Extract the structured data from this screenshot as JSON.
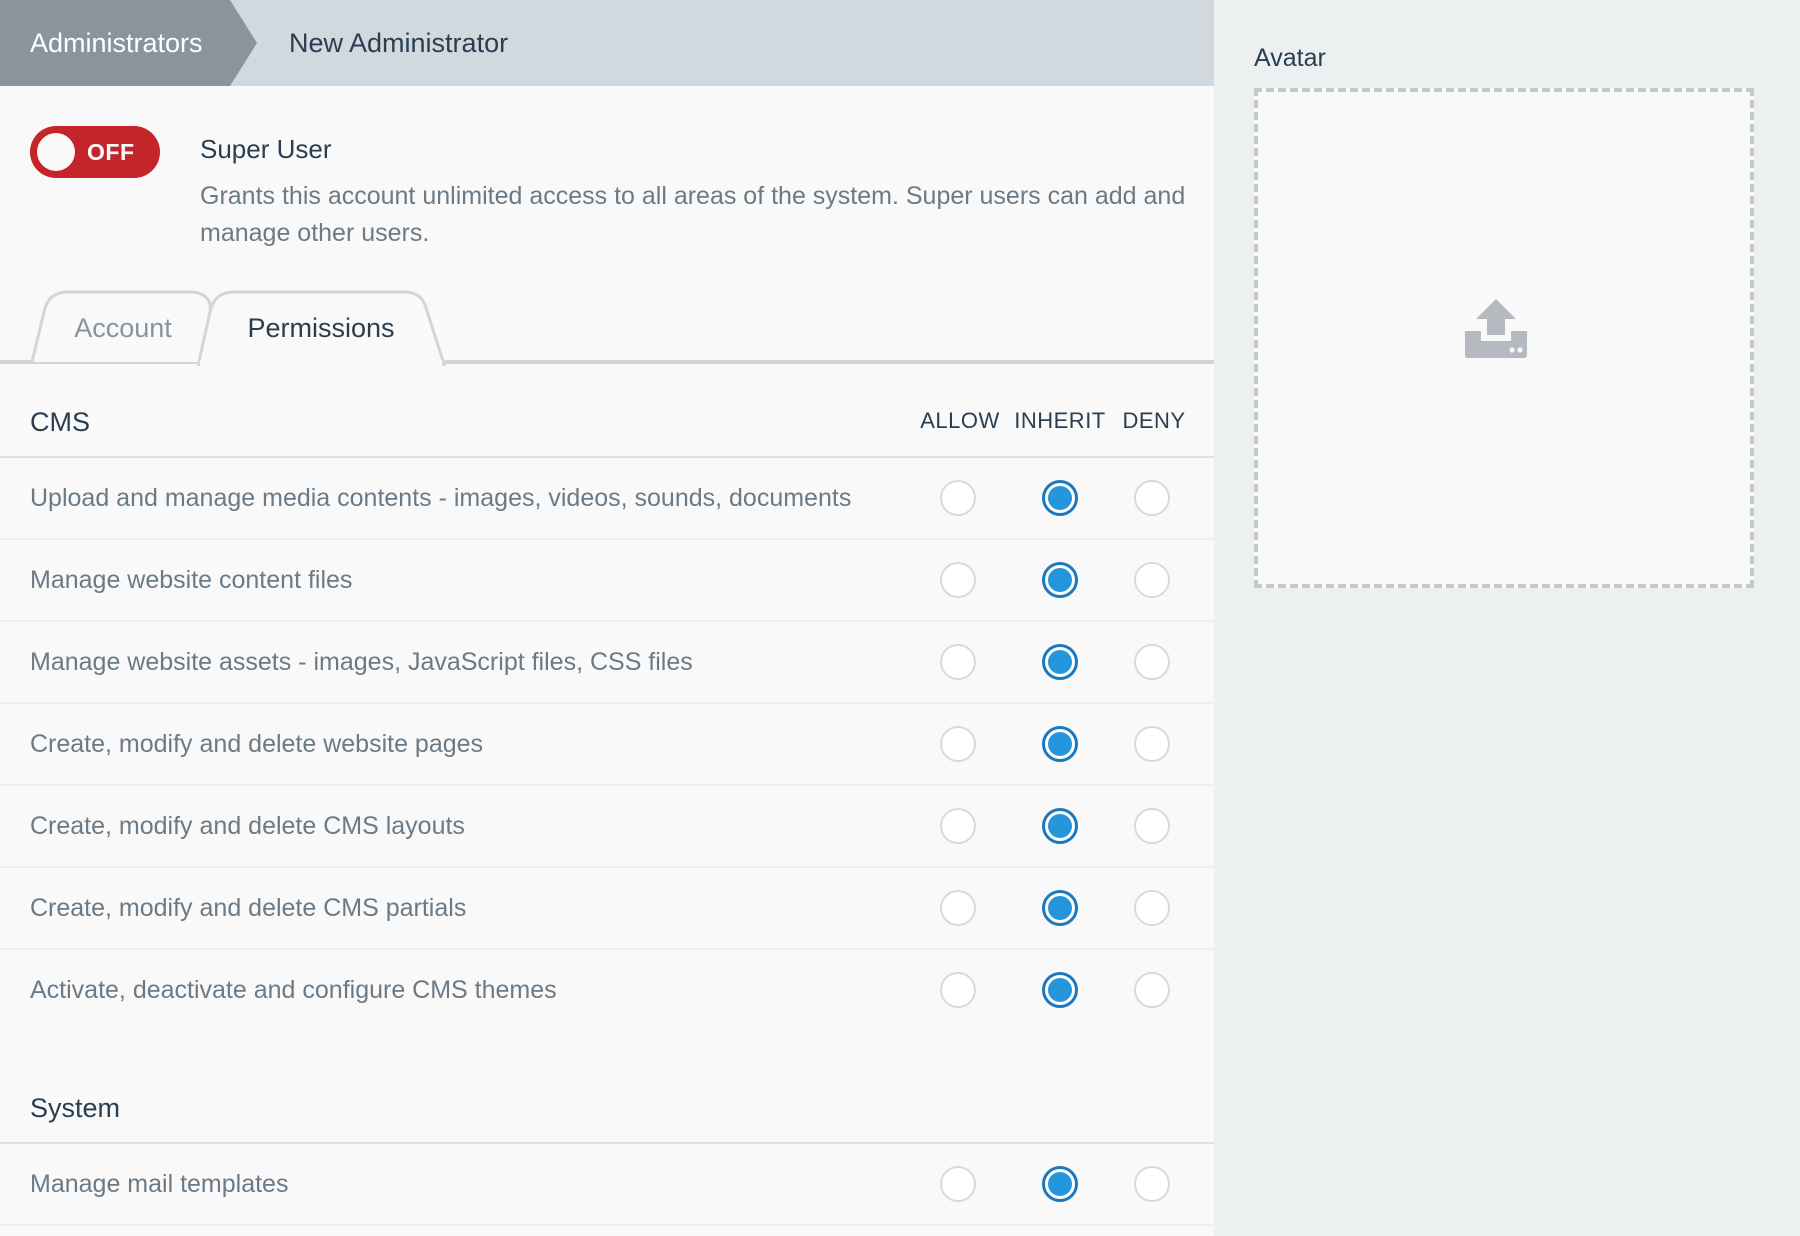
{
  "breadcrumb": {
    "parent": "Administrators",
    "current": "New Administrator"
  },
  "super_user": {
    "toggle_state": "OFF",
    "title": "Super User",
    "description": "Grants this account unlimited access to all areas of the system. Super users can add and manage other users."
  },
  "tabs": [
    {
      "label": "Account",
      "active": false
    },
    {
      "label": "Permissions",
      "active": true
    }
  ],
  "columns": {
    "allow": "ALLOW",
    "inherit": "INHERIT",
    "deny": "DENY"
  },
  "sections": [
    {
      "title": "CMS",
      "permissions": [
        {
          "label": "Upload and manage media contents - images, videos, sounds, documents",
          "value": "inherit"
        },
        {
          "label": "Manage website content files",
          "value": "inherit"
        },
        {
          "label": "Manage website assets - images, JavaScript files, CSS files",
          "value": "inherit"
        },
        {
          "label": "Create, modify and delete website pages",
          "value": "inherit"
        },
        {
          "label": "Create, modify and delete CMS layouts",
          "value": "inherit"
        },
        {
          "label": "Create, modify and delete CMS partials",
          "value": "inherit"
        },
        {
          "label": "Activate, deactivate and configure CMS themes",
          "value": "inherit"
        }
      ]
    },
    {
      "title": "System",
      "permissions": [
        {
          "label": "Manage mail templates",
          "value": "inherit"
        }
      ]
    }
  ],
  "avatar": {
    "label": "Avatar",
    "icon": "upload-icon"
  },
  "colors": {
    "toggle_off": "#c5242a",
    "radio_checked": "#2596dc",
    "breadcrumb_parent": "#8a949d",
    "breadcrumb_bg": "#d1d8de",
    "sidebar_bg": "#ecf0f1"
  }
}
